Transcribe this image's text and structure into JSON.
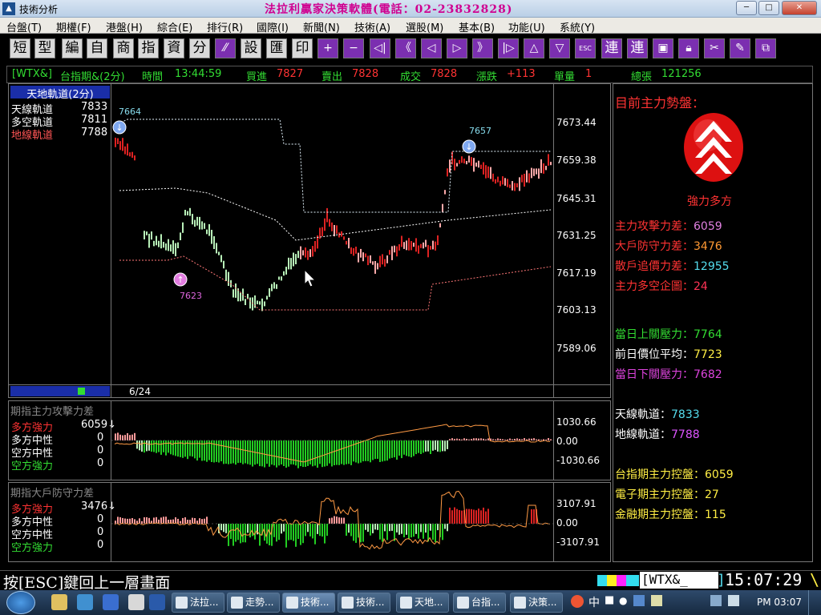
{
  "window": {
    "title": "技術分析",
    "banner": "法拉利贏家決策軟體(電話：02-23832828)",
    "controls": [
      "─",
      "□",
      "✕"
    ]
  },
  "menu": [
    "台盤(T)",
    "期權(F)",
    "港盤(H)",
    "綜合(E)",
    "排行(R)",
    "國際(I)",
    "新聞(N)",
    "技術(A)",
    "選股(M)",
    "基本(B)",
    "功能(U)",
    "系統(Y)"
  ],
  "toolbar": {
    "text_buttons": [
      "短",
      "型",
      "編",
      "自",
      "商",
      "指",
      "資",
      "分"
    ],
    "text_buttons_2": [
      "設",
      "匯",
      "印"
    ],
    "nav_symbols": [
      "+",
      "−",
      "◁|",
      "《",
      "◁",
      "▷",
      "》",
      "|▷",
      "△",
      "▽"
    ],
    "esc_label": "ESC",
    "link_buttons": [
      "連",
      "連"
    ]
  },
  "quote": {
    "symbol": "[WTX&]",
    "name": "台指期&(2分)",
    "time_label": "時間",
    "time": "13:44:59",
    "bid_label": "買進",
    "bid": "7827",
    "ask_label": "賣出",
    "ask": "7828",
    "deal_label": "成交",
    "deal": "7828",
    "change_label": "漲跌",
    "change": "+113",
    "volume_label": "單量",
    "volume": "1",
    "total_label": "總張",
    "total": "121256"
  },
  "main_chart": {
    "panel_title": "天地軌道(2分)",
    "legend": [
      {
        "label": "天線軌道",
        "value": "7833",
        "color": "#ffffff"
      },
      {
        "label": "多空軌道",
        "value": "7811",
        "color": "#ffffff"
      },
      {
        "label": "地線軌道",
        "value": "7788",
        "color": "#ff5555"
      }
    ],
    "y_ticks": [
      "7673.44",
      "7659.38",
      "7645.31",
      "7631.25",
      "7617.19",
      "7603.13",
      "7589.06"
    ],
    "date_label": "6/24",
    "marker_high": "7664",
    "marker_mid": "7657",
    "marker_low": "7623"
  },
  "sub1": {
    "title": "期指主力攻擊力差",
    "legend": [
      {
        "label": "多方強力",
        "value": "6059↓",
        "color": "#ff3333"
      },
      {
        "label": "多方中性",
        "value": "0",
        "color": "#ffffff"
      },
      {
        "label": "空方中性",
        "value": "0",
        "color": "#ffffff"
      },
      {
        "label": "空方強力",
        "value": "0",
        "color": "#33dd33"
      }
    ],
    "y_ticks": [
      "1030.66",
      "0.00",
      "-1030.66"
    ]
  },
  "sub2": {
    "title": "期指大戶防守力差",
    "legend": [
      {
        "label": "多方強力",
        "value": "3476↓",
        "color": "#ff3333"
      },
      {
        "label": "多方中性",
        "value": "0",
        "color": "#ffffff"
      },
      {
        "label": "空方中性",
        "value": "0",
        "color": "#ffffff"
      },
      {
        "label": "空方強力",
        "value": "0",
        "color": "#33dd33"
      }
    ],
    "y_ticks": [
      "3107.91",
      "0.00",
      "-3107.91"
    ]
  },
  "right_panel": {
    "heading": "目前主力勢盤：",
    "trend_label": "強力多方",
    "metrics_a": [
      {
        "label": "主力攻擊力差：",
        "value": "6059",
        "color": "#e080e0"
      },
      {
        "label": "大戶防守力差：",
        "value": "3476",
        "color": "#ff9933"
      },
      {
        "label": "散戶追價力差：",
        "value": "12955",
        "color": "#55ddee"
      },
      {
        "label": "主力多空企圖：",
        "value": "24",
        "color": "#ff3355"
      }
    ],
    "metrics_b": [
      {
        "label": "當日上關壓力：",
        "value": "7764",
        "color": "#33dd33"
      },
      {
        "label": "前日價位平均：",
        "value": "7723",
        "color": "#ffffff"
      },
      {
        "label": "當日下關壓力：",
        "value": "7682",
        "color": "#dd44dd"
      }
    ],
    "metrics_c": [
      {
        "label": "天線軌道：",
        "value": "7833",
        "color": "#55ddee"
      },
      {
        "label": "地線軌道：",
        "value": "7788",
        "color": "#dd55ff"
      }
    ],
    "metrics_d": [
      {
        "label": "台指期主力控盤：",
        "value": "6059",
        "color": "#ffee44"
      },
      {
        "label": "電子期主力控盤：",
        "value": "27",
        "color": "#ffee44"
      },
      {
        "label": "金融期主力控盤：",
        "value": "115",
        "color": "#ffee44"
      }
    ]
  },
  "bottom": {
    "esc_hint": "按[ESC]鍵回上一層畫面",
    "symbol": "[WTX&_",
    "bracket": "]",
    "clock": "15:07:29",
    "tail": "\\"
  },
  "taskbar": {
    "items": [
      "法拉...",
      "走勢...",
      "技術...",
      "技術...",
      "天地...",
      "台指...",
      "決策..."
    ],
    "tray_chars": [
      "中",
      "■",
      "●"
    ],
    "time": "PM 03:07"
  }
}
